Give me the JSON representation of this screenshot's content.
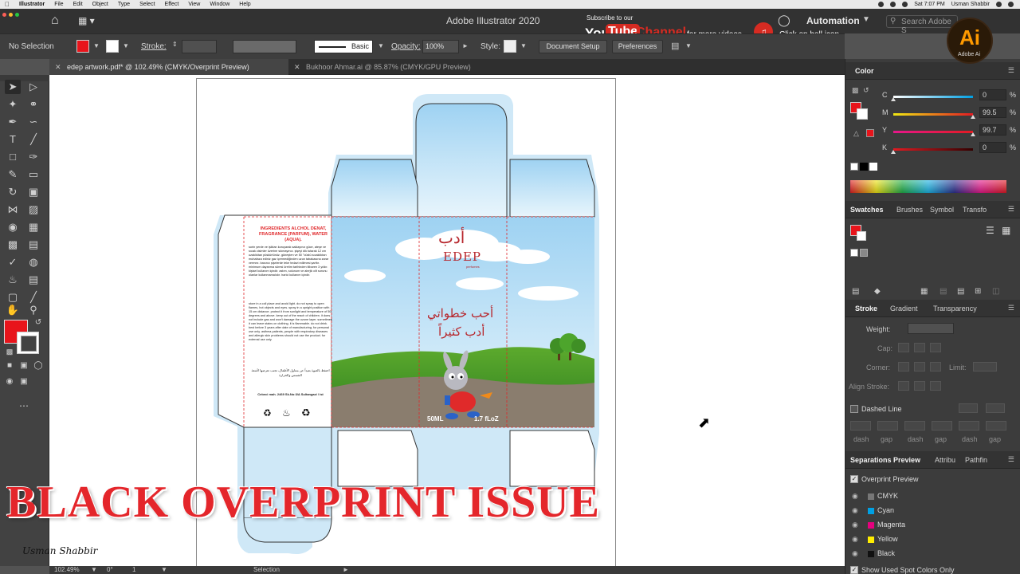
{
  "menubar": {
    "app": "Illustrator",
    "items": [
      "File",
      "Edit",
      "Object",
      "Type",
      "Select",
      "Effect",
      "View",
      "Window",
      "Help"
    ],
    "time": "Sat 7:07 PM",
    "user": "Usman Shabbir"
  },
  "titlebar": {
    "title": "Adobe Illustrator 2020",
    "workspace": "Automation",
    "search_placeholder": "Search Adobe S"
  },
  "youtube": {
    "subscribe": "Subscribe to our",
    "you": "You",
    "tube": "Tube",
    "channel": "Channel",
    "more": "for more videos",
    "click": "Click on bell icon"
  },
  "ai_logo": {
    "mark": "Ai",
    "label": "Adobe Ai"
  },
  "control": {
    "selection": "No Selection",
    "stroke_label": "Stroke:",
    "brush": "Basic",
    "opacity_label": "Opacity:",
    "opacity": "100%",
    "style_label": "Style:",
    "doc_setup": "Document Setup",
    "preferences": "Preferences"
  },
  "tabs": [
    {
      "label": "edep artwork.pdf* @ 102.49% (CMYK/Overprint Preview)"
    },
    {
      "label": "Bukhoor Ahmar.ai @ 85.87% (CMYK/GPU Preview)"
    }
  ],
  "artwork": {
    "ingredients_title": "INGREDIENTS ALCHOL DENAT, FRAGRANCE (PARFUM), WATER (AQUA).",
    "ingredients_body": "sorin yerde ve işiktan koruyarak saklayınız güce, ateşe ve sıcak cisimler üzerine sıkmayınız. şişeyi dik tutarak 12 cm uzaklıktan püskürtünüz. güneşten ve 50 °cüstü sıcaklıktan muhafaza ediniz gaz içermediğinden uzun tabakasına zarar vermez. basıncı şişelerde teke tedavi edilmesi şarttır. minimum dayanma süresi üretim tarihinden itibaren 3 yıldır. kişisel kullanım içindir. astım, solunum ve alerjik cilt sorunu olanlar kullanmamalıdır. harici kullanım içindir.",
    "ingredients_store": "store in a coll place and avoid light. do not spray to open flames, hot objects and eyes. spray in a upright position with 15 cm distance. protect it from sunlight and temperature of 50 degrees and above. keep out of the reach of children. it does not include gas and won't damage the ozone layer. sometimes it can leave stains on clothing. it is flammable. do not drink. best before 3 years after date of manufacturing. for personal use only. asthma patients, people with respiratory diseases and allergic skin problems should not use the product. for external use only.",
    "ingredients_ar": "احتفظ بالعبوة بعيداً عن متناول الأطفال، تجنب تعرضها لأشعة الشمس والحرارة",
    "address": "Cebeci mah. 2469 Sk.No:3/A Sultangazi / ist",
    "brand_ar": "أدب",
    "brand_latin": "EDEP",
    "brand_sub": "perfumes",
    "slogan_1": "أحب خطواتي",
    "slogan_2": "أدب كثيراً",
    "volume_ml": "50ML",
    "volume_oz": "1.7 fLoZ"
  },
  "panels": {
    "color": {
      "title": "Color",
      "rows": [
        {
          "label": "C",
          "value": "0",
          "pos": 0
        },
        {
          "label": "M",
          "value": "99.5",
          "pos": 99.5
        },
        {
          "label": "Y",
          "value": "99.7",
          "pos": 99.7
        },
        {
          "label": "K",
          "value": "0",
          "pos": 0
        }
      ],
      "pct": "%"
    },
    "swatches_tabs": [
      "Swatches",
      "Brushes",
      "Symbol",
      "Transfo"
    ],
    "stroke_tabs": [
      "Stroke",
      "Gradient",
      "Transparency"
    ],
    "stroke": {
      "weight": "Weight:",
      "cap": "Cap:",
      "corner": "Corner:",
      "limit": "Limit:",
      "align": "Align Stroke:",
      "dashed": "Dashed Line",
      "dash_labels": [
        "dash",
        "gap",
        "dash",
        "gap",
        "dash",
        "gap"
      ]
    },
    "sep_tabs": [
      "Separations Preview",
      "Attribu",
      "Pathfin"
    ],
    "separations": {
      "overprint": "Overprint Preview",
      "rows": [
        {
          "name": "CMYK",
          "color": "#777777"
        },
        {
          "name": "Cyan",
          "color": "#00a0e3"
        },
        {
          "name": "Magenta",
          "color": "#e6007e"
        },
        {
          "name": "Yellow",
          "color": "#ffed00"
        },
        {
          "name": "Black",
          "color": "#111111"
        }
      ],
      "show_spot": "Show Used Spot Colors Only"
    }
  },
  "status": {
    "zoom": "102.49%",
    "angle": "0°",
    "artboard": "1",
    "mode": "Selection"
  },
  "overlay": {
    "title": "BLACK OVERPRINT ISSUE",
    "signature": "Usman Shabbir"
  },
  "colors": {
    "fill": "#e8141b",
    "accent": "#e4262b"
  }
}
